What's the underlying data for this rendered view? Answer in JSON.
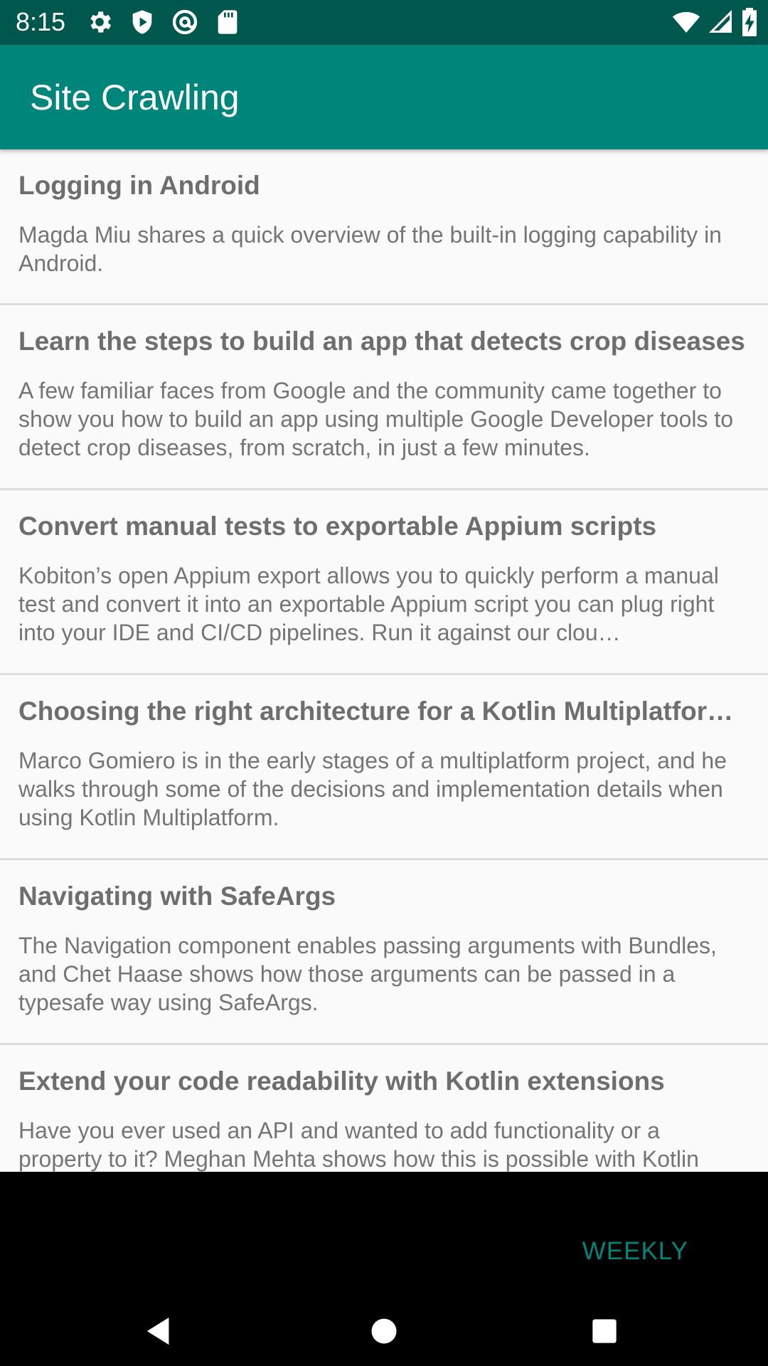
{
  "status_bar": {
    "time": "8:15",
    "left_icons": [
      "settings-icon",
      "shield-play-icon",
      "at-sign-icon",
      "sd-card-icon"
    ],
    "right_icons": [
      "wifi-icon",
      "signal-icon",
      "battery-charging-icon"
    ]
  },
  "app_bar": {
    "title": "Site Crawling"
  },
  "articles": [
    {
      "title": "Logging in Android",
      "description": "Magda Miu shares a quick overview of the built-in logging capability in Android."
    },
    {
      "title": "Learn the steps to build an app that detects crop diseases",
      "description": "A few familiar faces from Google and the community came together to show you how to build an app using multiple Google Developer tools to detect crop diseases, from scratch, in just a few minutes."
    },
    {
      "title": "Convert manual tests to exportable Appium scripts",
      "description": "Kobiton’s open Appium export allows you to quickly perform a manual test and convert it into an exportable Appium script you can plug right into your IDE and CI/CD pipelines. Run it against our clou…"
    },
    {
      "title": "Choosing the right architecture for a Kotlin Multiplatform…",
      "description": "Marco Gomiero is in the early stages of a multiplatform project, and he walks through some of the decisions and implementation details when using Kotlin Multiplatform."
    },
    {
      "title": "Navigating with SafeArgs",
      "description": "The Navigation component enables passing arguments with Bundles, and Chet Haase shows how those arguments can be passed in a typesafe way using SafeArgs."
    },
    {
      "title": "Extend your code readability with Kotlin extensions",
      "description": "Have you ever used an API and wanted to add functionality or a property to it? Meghan Mehta shows how this is possible with Kotlin"
    }
  ],
  "footer": {
    "weekly_label": "WEEKLY"
  },
  "nav_bar": {
    "icons": [
      "back-icon",
      "home-icon",
      "recents-icon"
    ]
  },
  "colors": {
    "status_bar": "#00574d",
    "app_bar": "#00857a",
    "accent": "#00857a",
    "title_text": "#6e6e6e",
    "body_text": "#757575",
    "divider": "#dcdcdc"
  }
}
